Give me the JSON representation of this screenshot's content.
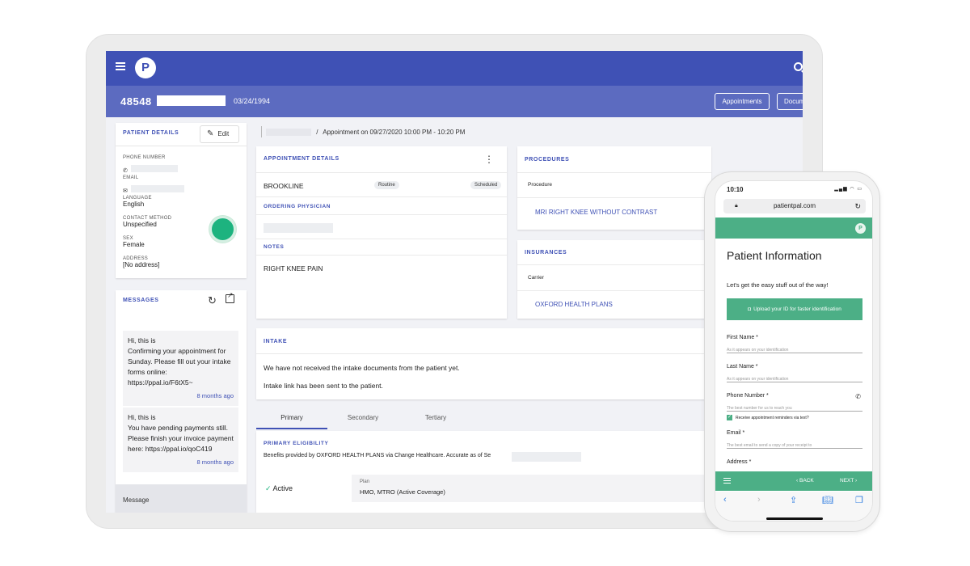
{
  "header": {
    "logo_letter": "P",
    "patient_id": "48548",
    "dob": "03/24/1994",
    "buttons": {
      "appointments": "Appointments",
      "documents": "Docum"
    }
  },
  "patient_details": {
    "title": "PATIENT DETAILS",
    "edit_label": "Edit",
    "phone_label": "PHONE NUMBER",
    "email_label": "EMAIL",
    "language_label": "LANGUAGE",
    "language": "English",
    "contact_label": "CONTACT METHOD",
    "contact": "Unspecified",
    "sex_label": "SEX",
    "sex": "Female",
    "address_label": "ADDRESS",
    "address": "[No address]"
  },
  "messages": {
    "title": "MESSAGES",
    "items": [
      {
        "greeting": "Hi, this is",
        "body": "Confirming your appointment for Sunday. Please fill out your intake forms online: https://ppal.io/F6tX5~",
        "time": "8 months ago"
      },
      {
        "greeting": "Hi, this is",
        "body": "You have pending payments still. Please finish your invoice payment here: https://ppal.io/qoC419",
        "time": "8 months ago"
      }
    ],
    "input_placeholder": "Message"
  },
  "breadcrumb": {
    "appointment": "Appointment on 09/27/2020 10:00 PM - 10:20 PM"
  },
  "appointment_details": {
    "title": "APPOINTMENT DETAILS",
    "location": "BROOKLINE",
    "type_chip": "Routine",
    "status_chip": "Scheduled",
    "ordering_title": "ORDERING PHYSICIAN",
    "notes_title": "NOTES",
    "notes": "RIGHT KNEE PAIN"
  },
  "procedures": {
    "title": "PROCEDURES",
    "column": "Procedure",
    "item": "MRI RIGHT KNEE WITHOUT CONTRAST"
  },
  "insurances": {
    "title": "INSURANCES",
    "column": "Carrier",
    "item": "OXFORD HEALTH PLANS"
  },
  "intake": {
    "title": "INTAKE",
    "line1": "We have not received the intake documents from the patient yet.",
    "line2": "Intake link has been sent to the patient."
  },
  "tabs": [
    "Primary",
    "Secondary",
    "Tertiary"
  ],
  "eligibility": {
    "title": "PRIMARY ELIGIBILITY",
    "desc": "Benefits provided by OXFORD HEALTH PLANS via Change Healthcare. Accurate as of Se",
    "status": "Active",
    "plan_label": "Plan",
    "plan": "HMO, MTRO (Active Coverage)"
  },
  "phone": {
    "time": "10:10",
    "url": "patientpal.com",
    "avatar": "P",
    "title": "Patient Information",
    "subtitle": "Let's get the easy stuff out of the way!",
    "upload": "Upload your ID for faster identification",
    "fields": [
      {
        "label": "First Name *",
        "hint": "As it appears on your identification"
      },
      {
        "label": "Last Name *",
        "hint": "As it appears on your identification"
      },
      {
        "label": "Phone Number *",
        "hint": "The best number for us to reach you"
      },
      {
        "label": "Email *",
        "hint": "The best email to send a copy of your receipt to"
      },
      {
        "label": "Address *",
        "hint": ""
      }
    ],
    "checkbox_label": "Receive appointment reminders via text?",
    "back": "BACK",
    "next": "NEXT"
  }
}
